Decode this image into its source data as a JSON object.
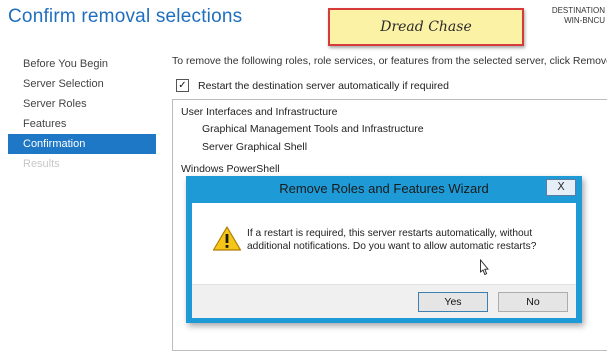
{
  "header": {
    "title": "Confirm removal selections",
    "destination_label": "DESTINATION",
    "destination_server": "WIN-BNCU"
  },
  "note": {
    "text": "Dread Chase",
    "border_color": "#d63a3a",
    "background": "#fbf2a6"
  },
  "sidebar": {
    "items": [
      {
        "label": "Before You Begin",
        "state": "normal"
      },
      {
        "label": "Server Selection",
        "state": "normal"
      },
      {
        "label": "Server Roles",
        "state": "normal"
      },
      {
        "label": "Features",
        "state": "normal"
      },
      {
        "label": "Confirmation",
        "state": "active"
      },
      {
        "label": "Results",
        "state": "disabled"
      }
    ]
  },
  "main": {
    "intro": "To remove the following roles, role services, or features from the selected server, click Remove.",
    "restart_checkbox": {
      "label": "Restart the destination server automatically if required",
      "checked": true,
      "mark": "✓"
    },
    "list": [
      {
        "text": "User Interfaces and Infrastructure",
        "level": 0
      },
      {
        "text": "Graphical Management Tools and Infrastructure",
        "level": 1
      },
      {
        "text": "Server Graphical Shell",
        "level": 1
      },
      {
        "text": "Windows PowerShell",
        "level": 0
      }
    ]
  },
  "dialog": {
    "title": "Remove Roles and Features Wizard",
    "close_glyph": "X",
    "icon": "warning-icon",
    "message": "If a restart is required, this server restarts automatically, without additional notifications. Do you want to allow automatic restarts?",
    "yes_label": "Yes",
    "no_label": "No",
    "accent": "#1e9bd7"
  }
}
